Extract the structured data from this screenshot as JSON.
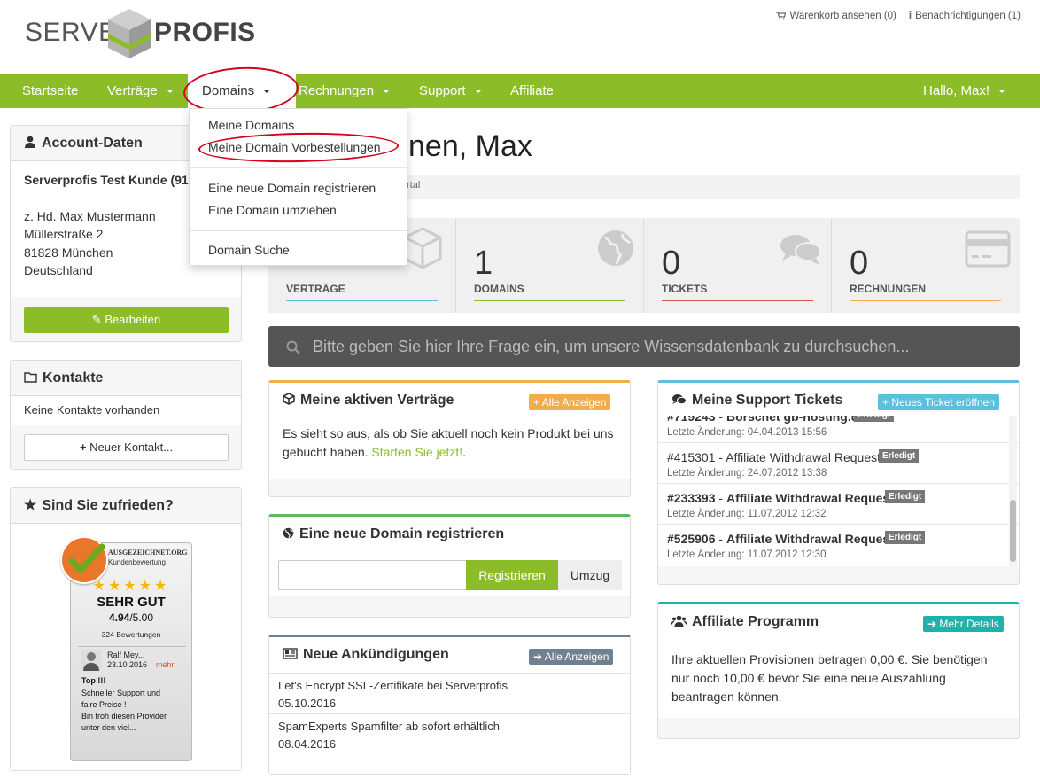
{
  "header": {
    "logo_left": "SERVER",
    "logo_right": "PROFIS",
    "cart": "Warenkorb ansehen (0)",
    "notifications": "Benachrichtigungen (1)"
  },
  "nav": {
    "items": [
      "Startseite",
      "Verträge",
      "Domains",
      "Rechnungen",
      "Support",
      "Affiliate"
    ],
    "greeting": "Hallo, Max!"
  },
  "dropdown": {
    "items": [
      "Meine Domains",
      "Meine Domain Vorbestellungen",
      "Eine neue Domain registrieren",
      "Eine Domain umziehen",
      "Domain Suche"
    ]
  },
  "page": {
    "title": "nen, Max",
    "breadcrumb": "rtal"
  },
  "account": {
    "title": "Account-Daten",
    "name": "Serverprofis Test Kunde (91",
    "address": [
      "z. Hd. Max Mustermann",
      "Müllerstraße 2",
      "81828 München",
      "Deutschland"
    ],
    "edit_button": "Bearbeiten"
  },
  "contacts": {
    "title": "Kontakte",
    "empty": "Keine Kontakte vorhanden",
    "new_button": "Neuer Kontakt..."
  },
  "satisfaction": {
    "title": "Sind Sie zufrieden?",
    "badge": {
      "brand": "AUSGEZEICHNET.ORG",
      "subtitle": "Kundenbewertung",
      "stars": 5,
      "rating_text": "SEHR GUT",
      "score": "4.94",
      "score_max": "/5.00",
      "reviews": "324 Bewertungen",
      "reviewer": "Ralf Mey...",
      "review_date": "23.10.2016",
      "more": "mehr",
      "review_title": "Top !!!",
      "review_lines": [
        "Schneller Support und",
        "faire Preise !",
        "Bin froh diesen Provider",
        "unter den viel..."
      ]
    }
  },
  "stats": [
    {
      "value": "0",
      "label": "VERTRÄGE",
      "color": "#5bc0de"
    },
    {
      "value": "1",
      "label": "DOMAINS",
      "color": "#8cbd29"
    },
    {
      "value": "0",
      "label": "TICKETS",
      "color": "#d9534f"
    },
    {
      "value": "0",
      "label": "RECHNUNGEN",
      "color": "#f0ad4e"
    }
  ],
  "kb_search": {
    "placeholder": "Bitte geben Sie hier Ihre Frage ein, um unsere Wissensdatenbank zu durchsuchen..."
  },
  "contracts": {
    "title": "Meine aktiven Verträge",
    "button": "Alle Anzeigen",
    "text": "Es sieht so aus, als ob Sie aktuell noch kein Produkt bei uns gebucht haben.",
    "link": "Starten Sie jetzt!",
    "after_link": "."
  },
  "domain_register": {
    "title": "Eine neue Domain registrieren",
    "register_button": "Registrieren",
    "transfer_button": "Umzug"
  },
  "announcements": {
    "title": "Neue Ankündigungen",
    "button": "Alle Anzeigen",
    "items": [
      {
        "title": "Let's Encrypt SSL-Zertifikate bei Serverprofis",
        "date": "05.10.2016"
      },
      {
        "title": "SpamExperts Spamfilter ab sofort erhältlich",
        "date": "08.04.2016"
      }
    ]
  },
  "tickets": {
    "title": "Meine Support Tickets",
    "button": "Neues Ticket eröffnen",
    "status": "Erledigt",
    "items": [
      {
        "id": "#719243",
        "subject": "Borschet gb-hosting.de",
        "date": "Letzte Änderung: 04.04.2013 15:56"
      },
      {
        "id": "#415301",
        "subject": "Affiliate Withdrawal Request",
        "date": "Letzte Änderung: 24.07.2012 13:38"
      },
      {
        "id": "#233393",
        "subject": "Affiliate Withdrawal Request",
        "date": "Letzte Änderung: 11.07.2012 12:32"
      },
      {
        "id": "#525906",
        "subject": "Affiliate Withdrawal Request",
        "date": "Letzte Änderung: 11.07.2012 12:30"
      }
    ]
  },
  "affiliate": {
    "title": "Affiliate Programm",
    "button": "Mehr Details",
    "text": "Ihre aktuellen Provisionen betragen 0,00 €. Sie benötigen nur noch 10,00 € bevor Sie eine neue Auszahlung beantragen können."
  }
}
